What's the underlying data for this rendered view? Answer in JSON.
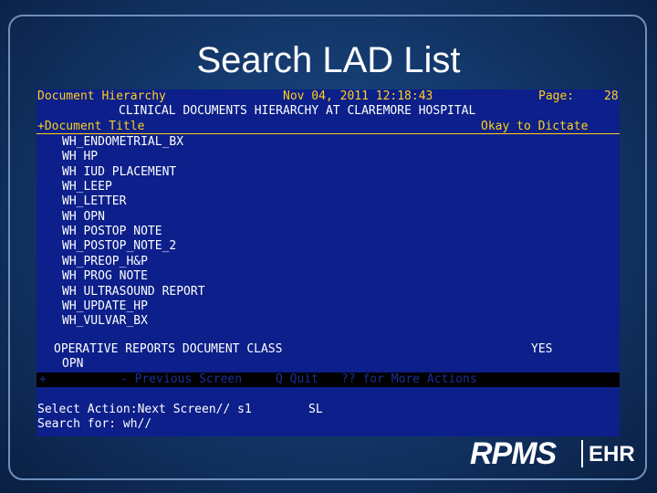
{
  "slide": {
    "title": "Search LAD List"
  },
  "terminal": {
    "header": {
      "left": "Document Hierarchy",
      "date": "Nov 04, 2011 12:18:43",
      "page_label": "Page:",
      "page_number": "28"
    },
    "subtitle": "CLINICAL DOCUMENTS HIERARCHY AT CLAREMORE HOSPITAL",
    "columns": {
      "title": "+Document Title",
      "dictate": "Okay to Dictate"
    },
    "documents": [
      "WH_ENDOMETRIAL_BX",
      "WH HP",
      "WH IUD PLACEMENT",
      "WH_LEEP",
      "WH_LETTER",
      "WH OPN",
      "WH POSTOP NOTE",
      "WH_POSTOP_NOTE_2",
      "WH_PREOP_H&P",
      "WH PROG NOTE",
      "WH ULTRASOUND REPORT",
      "WH_UPDATE_HP",
      "WH_VULVAR_BX"
    ],
    "class_row": {
      "name": "OPERATIVE REPORTS DOCUMENT CLASS",
      "dictate": "YES"
    },
    "class_item": "OPN",
    "command_bar": {
      "marker": "+",
      "previous": "- Previous Screen",
      "quit": "Q Quit",
      "more": "?? for More Actions"
    },
    "prompt": {
      "action": "Select Action:Next Screen// s1",
      "action_value": "SL",
      "search": "Search for: wh//"
    }
  },
  "logo": {
    "brand": "RPMS",
    "suffix": "EHR"
  }
}
